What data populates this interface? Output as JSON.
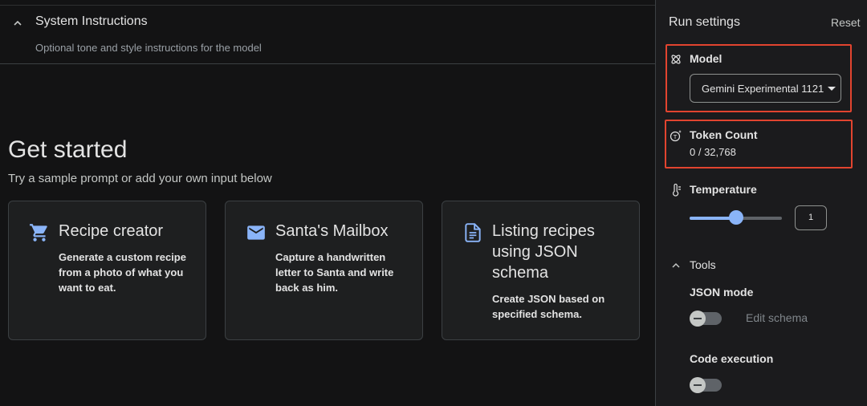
{
  "system_instructions": {
    "title": "System Instructions",
    "subtitle": "Optional tone and style instructions for the model"
  },
  "get_started": {
    "title": "Get started",
    "subtitle": "Try a sample prompt or add your own input below"
  },
  "cards": [
    {
      "icon": "shopping-cart-icon",
      "title": "Recipe creator",
      "description": "Generate a custom recipe from a photo of what you want to eat."
    },
    {
      "icon": "mail-icon",
      "title": "Santa's Mailbox",
      "description": "Capture a handwritten letter to Santa and write back as him."
    },
    {
      "icon": "document-icon",
      "title": "Listing recipes using JSON schema",
      "description": "Create JSON based on specified schema."
    }
  ],
  "run_settings": {
    "title": "Run settings",
    "reset_label": "Reset",
    "model": {
      "label": "Model",
      "selected": "Gemini Experimental 1121"
    },
    "token_count": {
      "label": "Token Count",
      "value": "0 / 32,768"
    },
    "temperature": {
      "label": "Temperature",
      "value": "1",
      "fraction": 0.5
    },
    "tools": {
      "label": "Tools",
      "json_mode": {
        "label": "JSON mode",
        "edit_schema_label": "Edit schema",
        "enabled": false
      },
      "code_execution": {
        "label": "Code execution",
        "enabled": false
      }
    }
  },
  "colors": {
    "accent": "#8ab4f8",
    "highlight": "#e2442f",
    "background": "#131314"
  }
}
